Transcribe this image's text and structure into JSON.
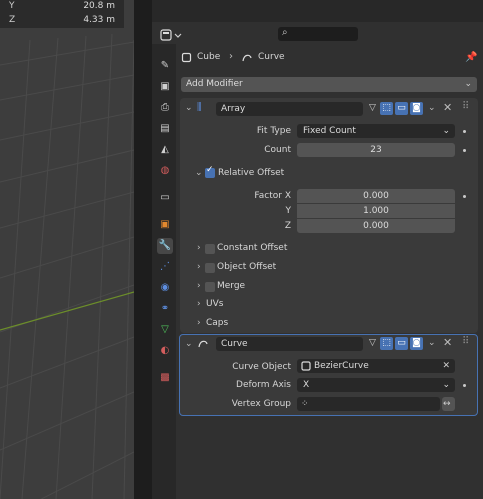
{
  "viewport": {
    "readout": [
      {
        "axis": "Y",
        "value": "20.8 m"
      },
      {
        "axis": "Z",
        "value": "4.33 m"
      }
    ]
  },
  "header": {
    "search_placeholder": "",
    "breadcrumb_object": "Cube",
    "breadcrumb_modifier": "Curve"
  },
  "add_modifier_label": "Add Modifier",
  "array": {
    "name": "Array",
    "fit_type_label": "Fit Type",
    "fit_type_value": "Fixed Count",
    "count_label": "Count",
    "count_value": "23",
    "relative_offset_label": "Relative Offset",
    "factor_x_label": "Factor X",
    "factor_x": "0.000",
    "y_label": "Y",
    "factor_y": "1.000",
    "z_label": "Z",
    "factor_z": "0.000",
    "sub_panels": [
      "Constant Offset",
      "Object Offset",
      "Merge",
      "UVs",
      "Caps"
    ]
  },
  "curve": {
    "name": "Curve",
    "curve_object_label": "Curve Object",
    "curve_object_value": "BezierCurve",
    "deform_axis_label": "Deform Axis",
    "deform_axis_value": "X",
    "vertex_group_label": "Vertex Group",
    "vertex_group_value": ""
  },
  "colors": {
    "accent": "#4772b3",
    "active_outline": "#4772b3"
  }
}
